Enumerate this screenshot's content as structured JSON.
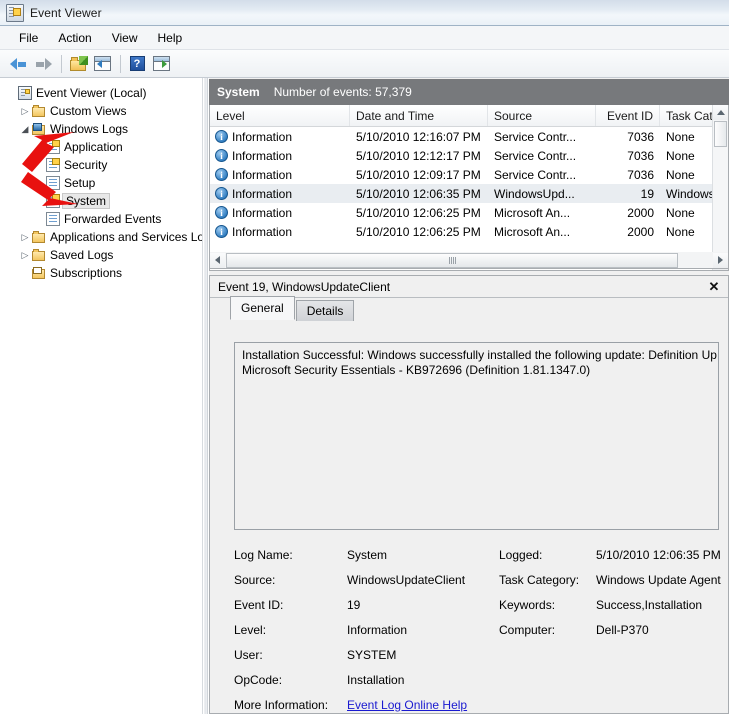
{
  "window": {
    "title": "Event Viewer",
    "icon": "event-viewer-icon"
  },
  "menubar": {
    "items": [
      "File",
      "Action",
      "View",
      "Help"
    ]
  },
  "toolbar": {
    "buttons": [
      {
        "name": "back-button",
        "icon": "back-arrow-icon"
      },
      {
        "name": "forward-button",
        "icon": "forward-arrow-icon"
      },
      {
        "name": "properties-button",
        "icon": "folder-pencil-icon"
      },
      {
        "name": "show-hide-console-tree-button",
        "icon": "console-tree-icon"
      },
      {
        "name": "help-button",
        "icon": "question-mark-icon"
      },
      {
        "name": "show-hide-action-pane-button",
        "icon": "action-pane-icon"
      }
    ]
  },
  "tree": {
    "items": [
      {
        "label": "Event Viewer (Local)",
        "indent": 0,
        "twisty": "",
        "icon": "console-root-icon",
        "selected": false
      },
      {
        "label": "Custom Views",
        "indent": 1,
        "twisty": "collapsed",
        "icon": "folder-icon",
        "selected": false
      },
      {
        "label": "Windows Logs",
        "indent": 1,
        "twisty": "expanded",
        "icon": "folder-windows-icon",
        "selected": false
      },
      {
        "label": "Application",
        "indent": 2,
        "twisty": "",
        "icon": "log-badge-icon",
        "selected": false
      },
      {
        "label": "Security",
        "indent": 2,
        "twisty": "",
        "icon": "log-badge-icon",
        "selected": false
      },
      {
        "label": "Setup",
        "indent": 2,
        "twisty": "",
        "icon": "log-icon",
        "selected": false
      },
      {
        "label": "System",
        "indent": 2,
        "twisty": "",
        "icon": "log-badge-icon",
        "selected": true
      },
      {
        "label": "Forwarded Events",
        "indent": 2,
        "twisty": "",
        "icon": "log-icon",
        "selected": false
      },
      {
        "label": "Applications and Services Lo",
        "indent": 1,
        "twisty": "collapsed",
        "icon": "folder-icon",
        "selected": false
      },
      {
        "label": "Saved Logs",
        "indent": 1,
        "twisty": "collapsed",
        "icon": "folder-saved-icon",
        "selected": false
      },
      {
        "label": "Subscriptions",
        "indent": 1,
        "twisty": "",
        "icon": "subscriptions-icon",
        "selected": false
      }
    ]
  },
  "annotations": {
    "arrows": [
      {
        "name": "red-arrow-windows-logs",
        "points_to": "Windows Logs",
        "color": "#e8110f",
        "direction": "up-right"
      },
      {
        "name": "red-arrow-system",
        "points_to": "System",
        "color": "#e8110f",
        "direction": "down-right"
      }
    ]
  },
  "list_header": {
    "log_name": "System",
    "event_count": "Number of events: 57,379"
  },
  "event_list": {
    "columns": [
      "Level",
      "Date and Time",
      "Source",
      "Event ID",
      "Task Cate"
    ],
    "rows": [
      {
        "icon": "information-icon",
        "level": "Information",
        "datetime": "5/10/2010 12:16:07 PM",
        "source": "Service Contr...",
        "event_id": "7036",
        "task_category": "None",
        "selected": false
      },
      {
        "icon": "information-icon",
        "level": "Information",
        "datetime": "5/10/2010 12:12:17 PM",
        "source": "Service Contr...",
        "event_id": "7036",
        "task_category": "None",
        "selected": false
      },
      {
        "icon": "information-icon",
        "level": "Information",
        "datetime": "5/10/2010 12:09:17 PM",
        "source": "Service Contr...",
        "event_id": "7036",
        "task_category": "None",
        "selected": false
      },
      {
        "icon": "information-icon",
        "level": "Information",
        "datetime": "5/10/2010 12:06:35 PM",
        "source": "WindowsUpd...",
        "event_id": "19",
        "task_category": "Windows",
        "selected": true
      },
      {
        "icon": "information-icon",
        "level": "Information",
        "datetime": "5/10/2010 12:06:25 PM",
        "source": "Microsoft An...",
        "event_id": "2000",
        "task_category": "None",
        "selected": false
      },
      {
        "icon": "information-icon",
        "level": "Information",
        "datetime": "5/10/2010 12:06:25 PM",
        "source": "Microsoft An...",
        "event_id": "2000",
        "task_category": "None",
        "selected": false
      }
    ]
  },
  "detail": {
    "title": "Event 19, WindowsUpdateClient",
    "close_label": "✕",
    "tabs": [
      {
        "label": "General",
        "active": true
      },
      {
        "label": "Details",
        "active": false
      }
    ],
    "description": "Installation Successful: Windows successfully installed the following update: Definition Up\nMicrosoft Security Essentials - KB972696 (Definition 1.81.1347.0)",
    "fields_left": [
      {
        "label": "Log Name:",
        "value": "System"
      },
      {
        "label": "Source:",
        "value": "WindowsUpdateClient"
      },
      {
        "label": "Event ID:",
        "value": "19"
      },
      {
        "label": "Level:",
        "value": "Information"
      },
      {
        "label": "User:",
        "value": "SYSTEM"
      },
      {
        "label": "OpCode:",
        "value": "Installation"
      }
    ],
    "fields_right": [
      {
        "label": "Logged:",
        "value": "5/10/2010 12:06:35 PM"
      },
      {
        "label": "Task Category:",
        "value": "Windows Update Agent"
      },
      {
        "label": "Keywords:",
        "value": "Success,Installation"
      },
      {
        "label": "Computer:",
        "value": "Dell-P370"
      }
    ],
    "more_info_label": "More Information:",
    "more_info_link": "Event Log Online Help"
  }
}
